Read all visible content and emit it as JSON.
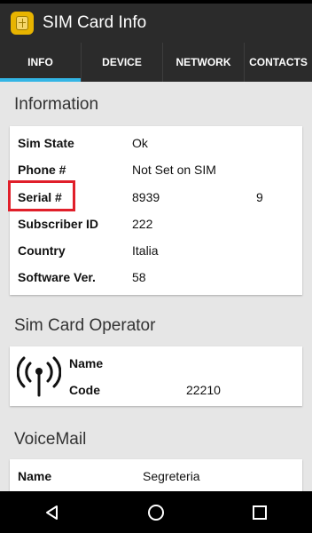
{
  "app": {
    "title": "SIM Card Info"
  },
  "tabs": [
    {
      "label": "INFO",
      "active": true
    },
    {
      "label": "DEVICE",
      "active": false
    },
    {
      "label": "NETWORK",
      "active": false
    },
    {
      "label": "CONTACTS",
      "active": false
    }
  ],
  "information": {
    "title": "Information",
    "rows": [
      {
        "label": "Sim State",
        "value": "Ok"
      },
      {
        "label": "Phone #",
        "value": "Not Set on SIM"
      },
      {
        "label": "Serial #",
        "value": "8939",
        "value_end": "9"
      },
      {
        "label": "Subscriber ID",
        "value": "222"
      },
      {
        "label": "Country",
        "value": "Italia"
      },
      {
        "label": "Software Ver.",
        "value": "58"
      }
    ]
  },
  "operator": {
    "title": "Sim Card Operator",
    "name_label": "Name",
    "name_value": "",
    "code_label": "Code",
    "code_value": "22210"
  },
  "voicemail": {
    "title": "VoiceMail",
    "name_label": "Name",
    "name_value": "Segreteria"
  },
  "colors": {
    "accent": "#33b5e5",
    "highlight": "#e01f2a",
    "appbar": "#2b2b2b",
    "background": "#e6e6e6"
  },
  "icons": {
    "app": "sim-card-icon",
    "operator": "antenna-icon",
    "back": "back-icon",
    "home": "home-icon",
    "recents": "recents-icon"
  }
}
